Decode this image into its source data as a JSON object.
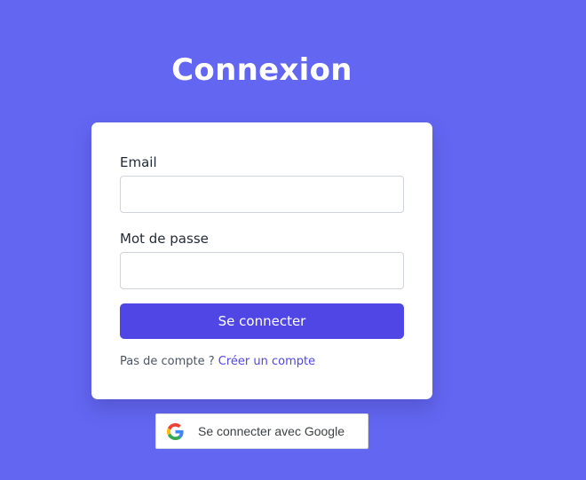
{
  "page": {
    "title": "Connexion"
  },
  "form": {
    "email_label": "Email",
    "email_value": "",
    "password_label": "Mot de passe",
    "password_value": "",
    "submit_label": "Se connecter",
    "signup_prompt": "Pas de compte ?",
    "signup_link": "Créer un compte"
  },
  "google": {
    "label": "Se connecter avec Google",
    "icon": "google-icon"
  },
  "colors": {
    "background": "#6366f1",
    "primary_button": "#4f46e5",
    "link": "#4f46e5",
    "card": "#ffffff"
  }
}
